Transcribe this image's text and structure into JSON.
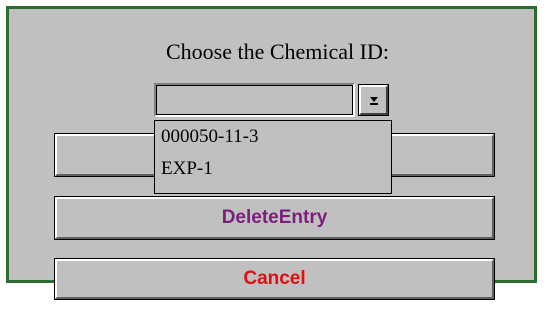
{
  "dialog": {
    "prompt": "Choose the Chemical ID:",
    "combo": {
      "value": "",
      "arrow_icon": "dropdown-arrow-icon"
    },
    "dropdown_options": [
      "000050-11-3",
      "EXP-1"
    ],
    "buttons": {
      "first_label": "",
      "delete_label": "DeleteEntry",
      "cancel_label": "Cancel"
    }
  },
  "colors": {
    "dialog_background": "#c0c0c0",
    "frame_border": "#2e6b2e",
    "delete_text": "#7b1f7b",
    "cancel_text": "#e01010"
  }
}
